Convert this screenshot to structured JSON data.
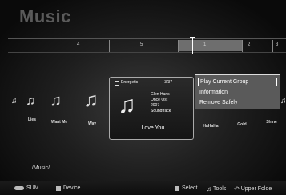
{
  "title": "Music",
  "timeline": {
    "groups": [
      "4",
      "5",
      "1",
      "2",
      "3"
    ]
  },
  "carousel": {
    "items": [
      {
        "label": "Lies",
        "icon": "music-note-icon"
      },
      {
        "label": "Want Me",
        "icon": "music-note-icon"
      },
      {
        "label": "Way",
        "icon": "music-note-icon"
      },
      {
        "label": "HaHaHa",
        "icon": "music-note-icon"
      },
      {
        "label": "Gold",
        "icon": "music-note-icon"
      },
      {
        "label": "Shine",
        "icon": "music-note-icon"
      }
    ],
    "note_glyph": "♫"
  },
  "focused_item": {
    "tag": "Energetic",
    "count": "3/37",
    "artist": "Glen Hans",
    "album": "Once Ost",
    "year": "2007",
    "genre": "Soundtrack",
    "title": "I Love You"
  },
  "tools_menu": {
    "items": [
      "Play Current Group",
      "Information",
      "Remove Safely"
    ],
    "selected_index": 0
  },
  "path": "../Music/",
  "bottom_bar": {
    "sum": "SUM",
    "device": "Device",
    "select": "Select",
    "tools": "Tools",
    "upper_folder": "Upper Folde"
  }
}
